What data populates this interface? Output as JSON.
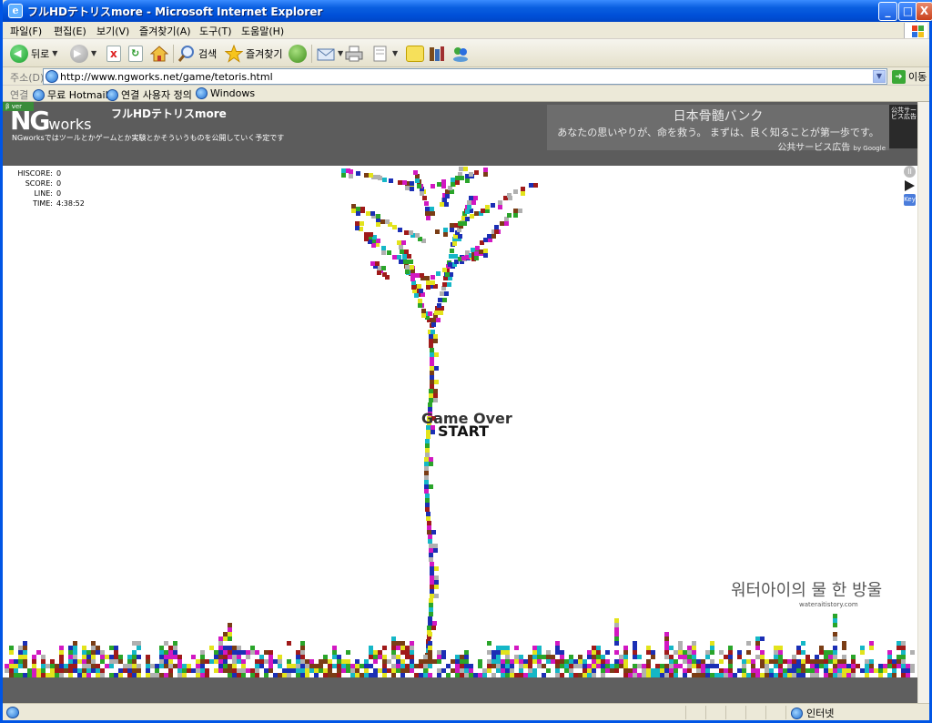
{
  "window": {
    "title": "フルHDテトリスmore - Microsoft Internet Explorer",
    "minimize": "_",
    "maximize": "□",
    "close": "X"
  },
  "menu": [
    "파일(F)",
    "편집(E)",
    "보기(V)",
    "즐겨찾기(A)",
    "도구(T)",
    "도움말(H)"
  ],
  "toolbar": {
    "back_label": "뒤로",
    "search_label": "검색",
    "favorites_label": "즐겨찾기"
  },
  "address": {
    "label": "주소(D)",
    "url": "http://www.ngworks.net/game/tetoris.html",
    "go_label": "이동"
  },
  "links": {
    "label": "연결",
    "items": [
      "무료 Hotmail",
      "연결 사용자 정의",
      "Windows"
    ]
  },
  "site": {
    "logo_big": "NG",
    "logo_works": "works",
    "badge": "β ver",
    "title": "フルHDテトリスmore",
    "subtitle": "NGworksではツールとかゲームとか実験とかそういうものを公開していく予定です",
    "ad": {
      "title": "日本骨髄バンク",
      "text": "あなたの思いやりが、命を救う。 まずは、良く知ることが第一歩です。",
      "footer": "公共サービス広告",
      "by_google": "by Google",
      "corner": "公共サービス広告"
    }
  },
  "game": {
    "stats": [
      {
        "label": "HISCORE:",
        "value": "0"
      },
      {
        "label": "SCORE:",
        "value": "0"
      },
      {
        "label": "LINE:",
        "value": "0"
      },
      {
        "label": "TIME:",
        "value": "4:38:52"
      }
    ],
    "game_over": "Game Over",
    "start": "START",
    "key_label": "Key",
    "pause_symbol": "II"
  },
  "watermark": {
    "title": "워터아이의 물 한 방울",
    "url": "wateraitistory.com"
  },
  "status": {
    "zone": "인터넷"
  },
  "colors": {
    "title_bar": "#0050d8",
    "site_header": "#5c5c5c",
    "ground": "#5f5f5f",
    "block_palette": [
      "#1b2fb5",
      "#d218c2",
      "#2aa52a",
      "#e3e31b",
      "#a01a1a",
      "#15b7c7",
      "#b0b0b0",
      "#7a3d15"
    ]
  }
}
